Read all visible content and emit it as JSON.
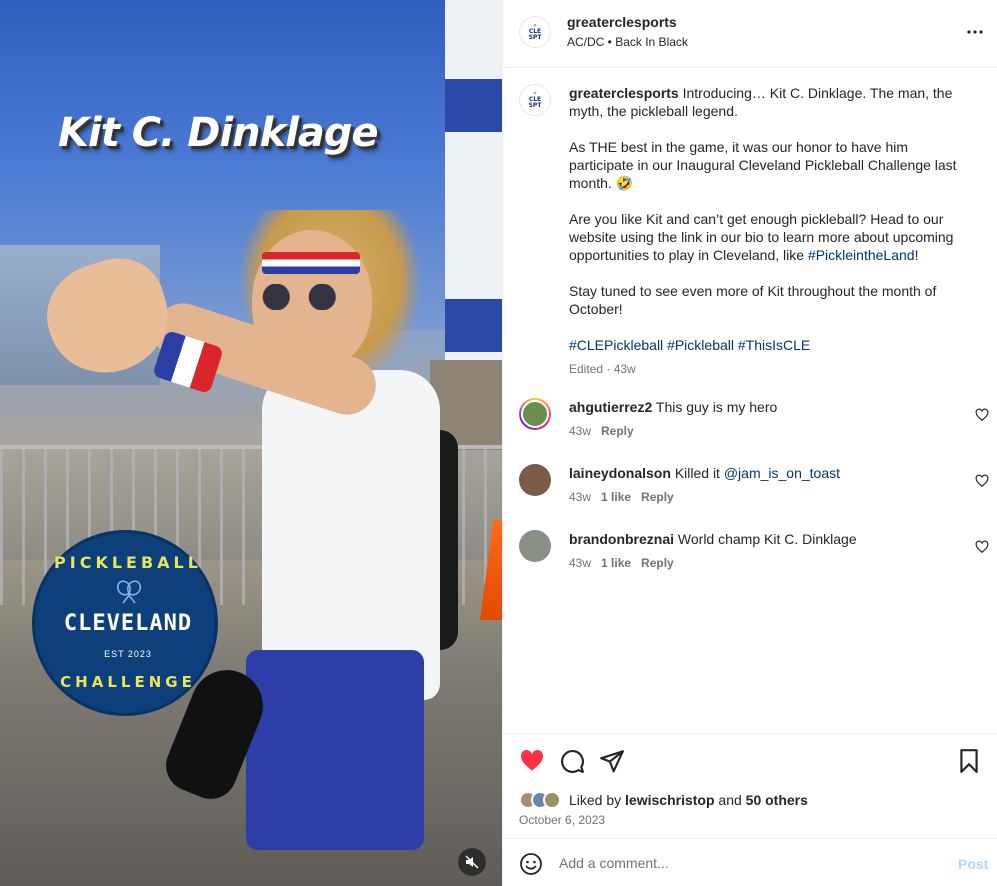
{
  "media": {
    "overlay_title": "Kit C. Dinklage",
    "badge": {
      "top_text": "PICKLEBALL",
      "main_text": "CLEVELAND",
      "est_text": "EST 2023",
      "bottom_text": "CHALLENGE"
    },
    "mute_icon": "speaker-muted-icon"
  },
  "header": {
    "username": "greaterclesports",
    "audio": "AC/DC • Back In Black",
    "more_icon": "more-horizontal-icon"
  },
  "caption": {
    "username": "greaterclesports",
    "p1": "Introducing… Kit C. Dinklage. The man, the myth, the pickleball legend.",
    "p2": "As THE best in the game, it was our honor to have him participate in our Inaugural Cleveland Pickleball Challenge last month. 🤣",
    "p3_before": "Are you like Kit and can’t get enough pickleball? Head to our website using the link in our bio to learn more about upcoming opportunities to play in Cleveland, like ",
    "p3_tag": "#PickleintheLand",
    "p3_after": "!",
    "p4": "Stay tuned to see even more of Kit throughout the month of October!",
    "tags": [
      "#CLEPickleball",
      "#Pickleball",
      "#ThisIsCLE"
    ],
    "edited": "Edited · 43w"
  },
  "comments": [
    {
      "user": "ahgutierrez2",
      "text": "This guy is my hero",
      "mention": "",
      "time": "43w",
      "likes": "",
      "reply": "Reply",
      "avatar_color": "#6b8e4e"
    },
    {
      "user": "laineydonalson",
      "text": "Killed it ",
      "mention": "@jam_is_on_toast",
      "time": "43w",
      "likes": "1 like",
      "reply": "Reply",
      "avatar_color": "#7a5a48"
    },
    {
      "user": "brandonbreznai",
      "text": "World champ Kit C. Dinklage",
      "mention": "",
      "time": "43w",
      "likes": "1 like",
      "reply": "Reply",
      "avatar_color": "#8a8f86"
    }
  ],
  "actions": {
    "liked_by_label": "Liked by",
    "liked_by_user": "lewischristop",
    "and_label": "and",
    "others_count": "50 others",
    "date": "October 6, 2023",
    "like_color": "#ff3040"
  },
  "add_comment": {
    "placeholder": "Add a comment...",
    "post_label": "Post"
  }
}
